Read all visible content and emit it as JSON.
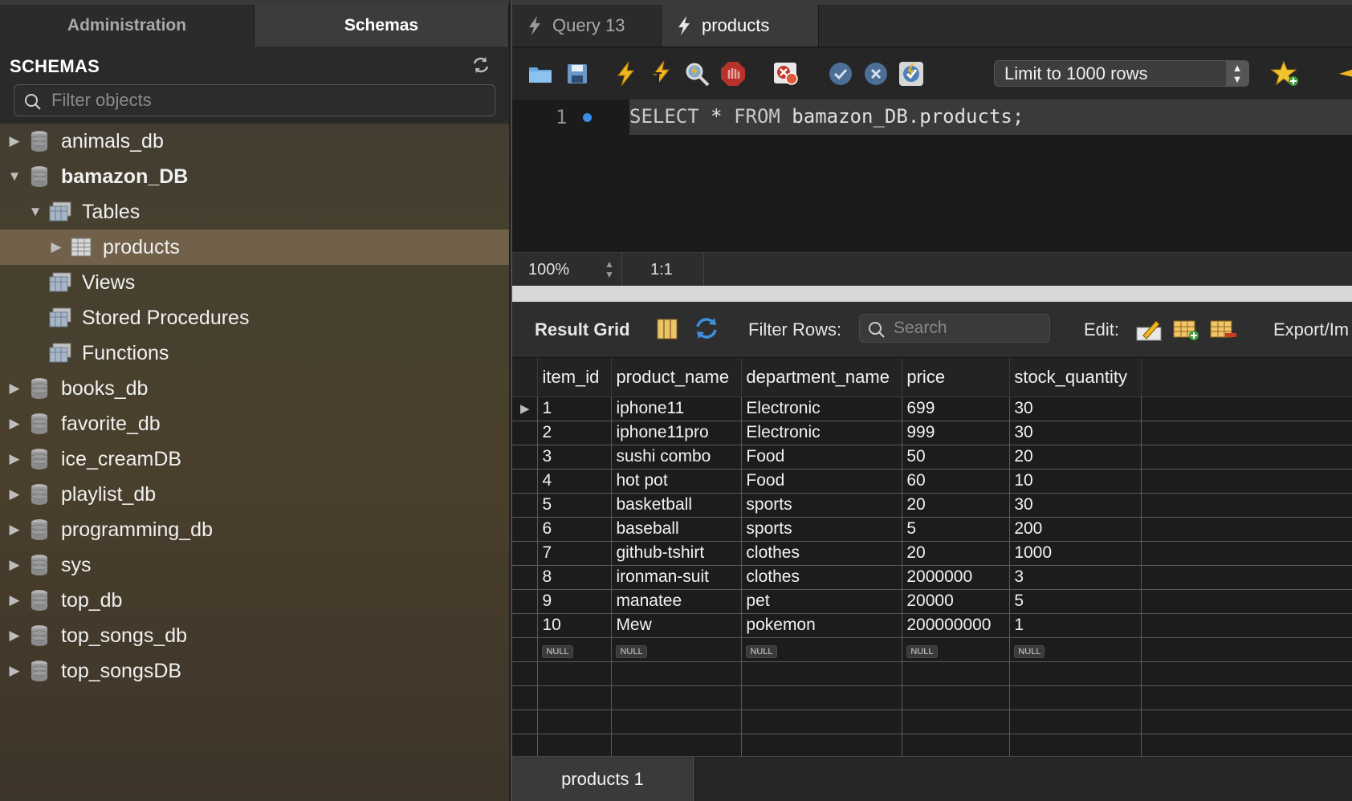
{
  "left_tabs": {
    "administration": "Administration",
    "schemas": "Schemas"
  },
  "schemas": {
    "title": "SCHEMAS",
    "filter_placeholder": "Filter objects",
    "tree": [
      {
        "label": "animals_db",
        "type": "database",
        "expanded": false
      },
      {
        "label": "bamazon_DB",
        "type": "database",
        "expanded": true
      },
      {
        "label": "Tables",
        "type": "folder",
        "expanded": true
      },
      {
        "label": "products",
        "type": "table",
        "selected": true
      },
      {
        "label": "Views",
        "type": "folder"
      },
      {
        "label": "Stored Procedures",
        "type": "folder"
      },
      {
        "label": "Functions",
        "type": "folder"
      },
      {
        "label": "books_db",
        "type": "database"
      },
      {
        "label": "favorite_db",
        "type": "database"
      },
      {
        "label": "ice_creamDB",
        "type": "database"
      },
      {
        "label": "playlist_db",
        "type": "database"
      },
      {
        "label": "programming_db",
        "type": "database"
      },
      {
        "label": "sys",
        "type": "database"
      },
      {
        "label": "top_db",
        "type": "database"
      },
      {
        "label": "top_songs_db",
        "type": "database"
      },
      {
        "label": "top_songsDB",
        "type": "database"
      }
    ]
  },
  "editor_tabs": [
    {
      "label": "Query 13",
      "active": false
    },
    {
      "label": "products",
      "active": true
    }
  ],
  "toolbar": {
    "limit_select": "Limit to 1000 rows",
    "icons": [
      "open-folder-icon",
      "save-icon",
      "execute-icon",
      "execute-current-icon",
      "explain-icon",
      "stop-icon",
      "toggle-error-icon",
      "commit-icon",
      "rollback-icon",
      "autocommit-icon",
      "favorite-icon"
    ]
  },
  "editor": {
    "line_number": "1",
    "code_keyword1": "SELECT",
    "code_star": " * ",
    "code_keyword2": "FROM",
    "code_rest": " bamazon_DB.products;"
  },
  "status": {
    "zoom": "100%",
    "cursor": "1:1"
  },
  "result_bar": {
    "label": "Result Grid",
    "filter_label": "Filter Rows:",
    "search_placeholder": "Search",
    "edit_label": "Edit:",
    "export_label": "Export/Im"
  },
  "grid": {
    "columns": [
      "item_id",
      "product_name",
      "department_name",
      "price",
      "stock_quantity"
    ],
    "rows": [
      [
        "1",
        "iphone11",
        "Electronic",
        "699",
        "30"
      ],
      [
        "2",
        "iphone11pro",
        "Electronic",
        "999",
        "30"
      ],
      [
        "3",
        "sushi combo",
        "Food",
        "50",
        "20"
      ],
      [
        "4",
        "hot pot",
        "Food",
        "60",
        "10"
      ],
      [
        "5",
        "basketball",
        "sports",
        "20",
        "30"
      ],
      [
        "6",
        "baseball",
        "sports",
        "5",
        "200"
      ],
      [
        "7",
        "github-tshirt",
        "clothes",
        "20",
        "1000"
      ],
      [
        "8",
        "ironman-suit",
        "clothes",
        "2000000",
        "3"
      ],
      [
        "9",
        "manatee",
        "pet",
        "20000",
        "5"
      ],
      [
        "10",
        "Mew",
        "pokemon",
        "200000000",
        "1"
      ]
    ],
    "null_text": "NULL",
    "current_row_marker": "▶"
  },
  "bottom_tab": "products 1"
}
